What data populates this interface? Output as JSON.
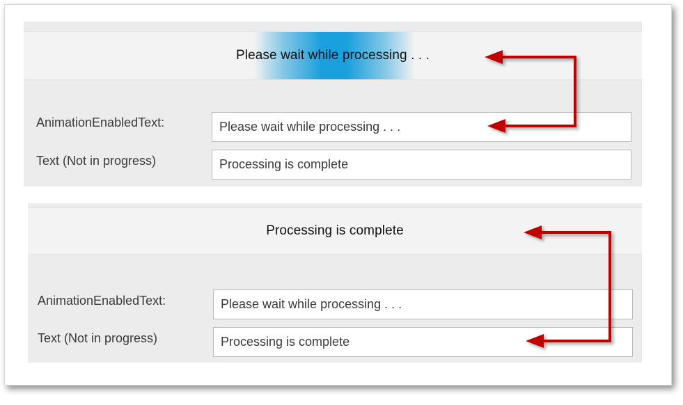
{
  "panel_top": {
    "progress_text": "Please wait while processing . . .",
    "animation_label": "AnimationEnabledText:",
    "animation_value": "Please wait while processing . . .",
    "text_label": "Text (Not in progress)",
    "text_value": "Processing is complete"
  },
  "panel_bottom": {
    "progress_text": "Processing is complete",
    "animation_label": "AnimationEnabledText:",
    "animation_value": "Please wait while processing . . .",
    "text_label": "Text (Not in progress)",
    "text_value": "Processing is complete"
  },
  "colors": {
    "progress_glow": "#1aa0dc",
    "arrow": "#c00000",
    "panel": "#ececec"
  }
}
